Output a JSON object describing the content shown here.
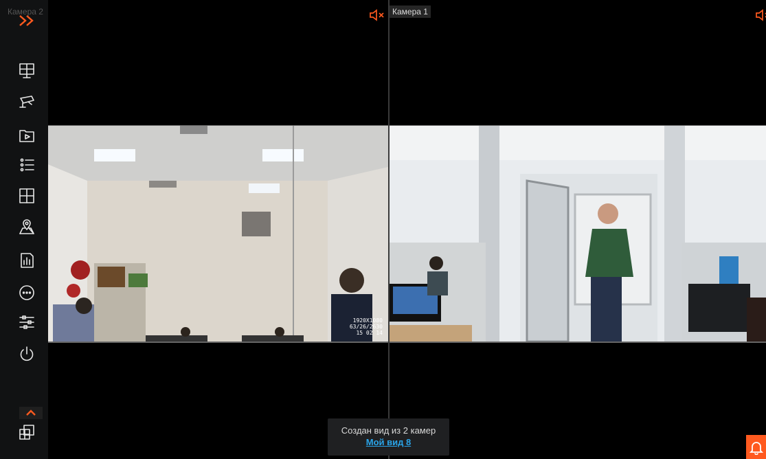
{
  "colors": {
    "accent": "#ff5a1f",
    "link": "#2aa4e8",
    "sidebar_bg": "#111213"
  },
  "sidebar": {
    "items": [
      {
        "icon": "monitor-layout-icon"
      },
      {
        "icon": "camera-icon"
      },
      {
        "icon": "archive-play-icon"
      },
      {
        "icon": "event-list-icon"
      },
      {
        "icon": "layout-grid-icon"
      },
      {
        "icon": "map-icon"
      },
      {
        "icon": "reports-icon"
      },
      {
        "icon": "more-icon"
      },
      {
        "icon": "settings-sliders-icon"
      },
      {
        "icon": "power-icon"
      }
    ],
    "bottom": {
      "icon": "layouts-icon"
    }
  },
  "cameras": [
    {
      "label": "Камера 2",
      "osd_lines": [
        "1920X1080",
        "63/26/2630",
        "15 02 14"
      ]
    },
    {
      "label": "Камера 1"
    }
  ],
  "toast": {
    "text": "Создан вид из 2 камер",
    "link": "Мой вид 8"
  }
}
